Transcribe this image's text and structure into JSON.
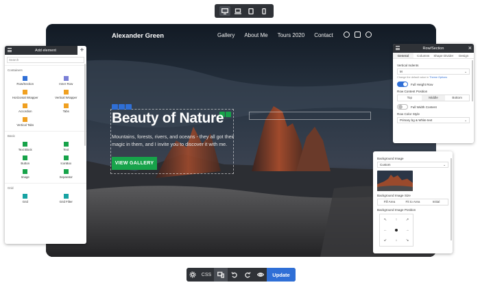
{
  "device_bar": {
    "devices": [
      {
        "name": "desktop-icon",
        "active": true
      },
      {
        "name": "laptop-icon",
        "active": false
      },
      {
        "name": "tablet-icon",
        "active": false
      },
      {
        "name": "mobile-icon",
        "active": false
      }
    ]
  },
  "site": {
    "logo": "Alexander Green",
    "nav": [
      "Gallery",
      "About Me",
      "Tours 2020",
      "Contact"
    ],
    "socials": [
      "facebook-icon",
      "instagram-icon",
      "tripadvisor-icon"
    ],
    "hero_title": "Beauty of Nature",
    "hero_text": "Mountains, forests, rivers, and oceans - they all got their magic in them, and I invite you to discover it with me.",
    "hero_button": "VIEW GALLERY"
  },
  "left_panel": {
    "title": "Add element",
    "search_placeholder": "Search",
    "groups": [
      {
        "label": "Containers",
        "items": [
          {
            "label": "Row/Section",
            "icon": "row-section-icon",
            "color": "#2f6fd6"
          },
          {
            "label": "Inner Row",
            "icon": "inner-row-icon",
            "color": "#7a7fd6"
          },
          {
            "label": "Horizontal Wrapper",
            "icon": "horizontal-wrapper-icon",
            "color": "#f0a020"
          },
          {
            "label": "Vertical Wrapper",
            "icon": "vertical-wrapper-icon",
            "color": "#f0a020"
          },
          {
            "label": "Accordion",
            "icon": "accordion-icon",
            "color": "#f0a020"
          },
          {
            "label": "Tabs",
            "icon": "tabs-icon",
            "color": "#f0a020"
          },
          {
            "label": "Vertical Tabs",
            "icon": "vertical-tabs-icon",
            "color": "#f0a020"
          }
        ]
      },
      {
        "label": "Basic",
        "items": [
          {
            "label": "Text Block",
            "icon": "text-block-icon",
            "color": "#17a34a"
          },
          {
            "label": "Text",
            "icon": "text-icon",
            "color": "#17a34a"
          },
          {
            "label": "Button",
            "icon": "button-icon",
            "color": "#17a34a"
          },
          {
            "label": "IconBox",
            "icon": "iconbox-icon",
            "color": "#17a34a"
          },
          {
            "label": "Image",
            "icon": "image-icon",
            "color": "#17a34a"
          },
          {
            "label": "Separator",
            "icon": "separator-icon",
            "color": "#17a34a"
          }
        ]
      },
      {
        "label": "Grid",
        "items": [
          {
            "label": "Grid",
            "icon": "grid-icon",
            "color": "#17a3a3"
          },
          {
            "label": "Grid Filter",
            "icon": "grid-filter-icon",
            "color": "#17a3a3"
          }
        ]
      }
    ]
  },
  "right_panel": {
    "title": "Row/Section",
    "tabs": [
      "General",
      "Columns",
      "Shape Divider",
      "Design"
    ],
    "active_tab": "General",
    "vertical_indents_label": "Vertical Indents",
    "vertical_indents_value": "M",
    "hint_prefix": "Change the default value in",
    "hint_link": "Theme Options",
    "full_height_label": "Full Height Row",
    "content_position_label": "Row Content Position",
    "content_positions": [
      "Top",
      "Middle",
      "Bottom"
    ],
    "full_width_label": "Full Width Content",
    "color_style_label": "Row Color Style",
    "color_style_value": "Primary bg & White text"
  },
  "bg_panel": {
    "image_label": "Background Image",
    "image_value": "Custom",
    "size_label": "Background Image Size",
    "sizes": [
      "Fill Area",
      "Fit to Area",
      "Initial"
    ],
    "position_label": "Background Image Position",
    "position_arrows": [
      "↖",
      "↑",
      "↗",
      "←",
      "",
      "→",
      "↙",
      "↓",
      "↘"
    ]
  },
  "bottom_bar": {
    "css_label": "CSS",
    "update_label": "Update"
  },
  "colors": {
    "accent_blue": "#2f6fd6",
    "accent_green": "#17a34a",
    "dark_ui": "#2f3237"
  }
}
